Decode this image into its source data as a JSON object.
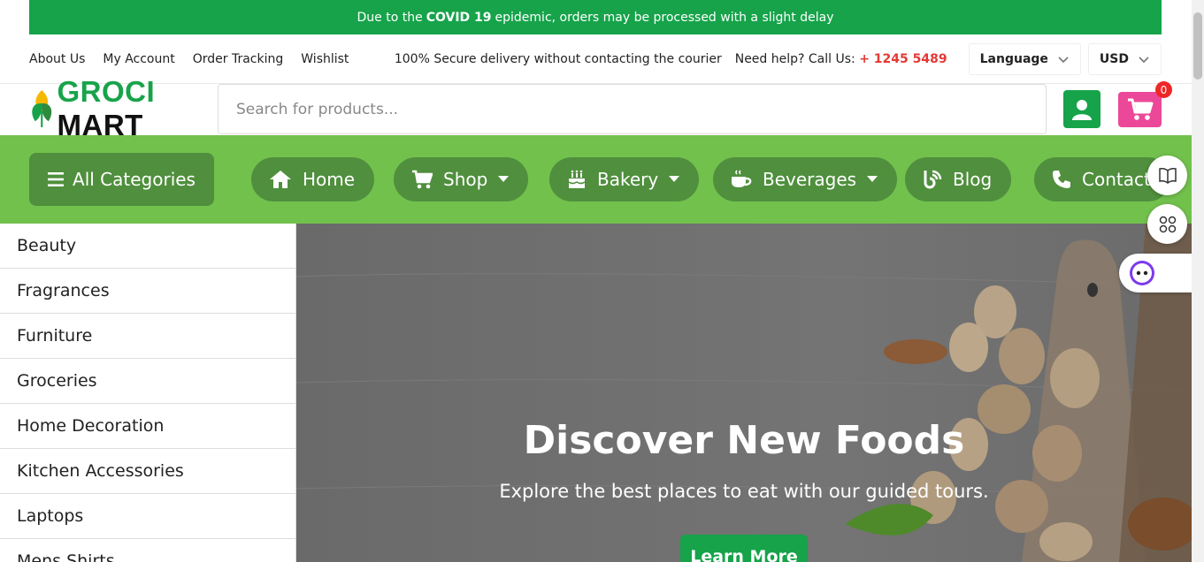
{
  "announcement": {
    "prefix": "Due to the",
    "highlight": "COVID 19",
    "suffix": "epidemic, orders may be processed with a slight delay"
  },
  "topbar": {
    "links": [
      "About Us",
      "My Account",
      "Order Tracking",
      "Wishlist"
    ],
    "secure_text": "100% Secure delivery without contacting the courier",
    "help_label": "Need help? Call Us:",
    "help_phone": "+ 1245 5489",
    "language_label": "Language",
    "currency_label": "USD"
  },
  "header": {
    "logo_part1": "GROCI",
    "logo_part2": "MART",
    "search_placeholder": "Search for products...",
    "cart_count": "0"
  },
  "nav": {
    "all_categories_label": "All Categories",
    "items": [
      {
        "label": "Home",
        "icon": "home-icon"
      },
      {
        "label": "Shop",
        "icon": "cart-icon"
      },
      {
        "label": "Bakery",
        "icon": "cake-icon"
      },
      {
        "label": "Beverages",
        "icon": "coffee-icon"
      },
      {
        "label": "Blog",
        "icon": "blog-icon"
      },
      {
        "label": "Contact",
        "icon": "phone-icon"
      }
    ]
  },
  "categories": [
    "Beauty",
    "Fragrances",
    "Furniture",
    "Groceries",
    "Home Decoration",
    "Kitchen Accessories",
    "Laptops",
    "Mens Shirts"
  ],
  "hero": {
    "title": "Discover New Foods",
    "subtitle": "Explore the best places to eat with our guided tours.",
    "button_label": "Learn More"
  },
  "colors": {
    "brand_green": "#16a34a",
    "nav_green": "#72c14d",
    "pill_green": "#4f8f3d",
    "cart_pink": "#ec4899",
    "phone_red": "#e53935"
  }
}
